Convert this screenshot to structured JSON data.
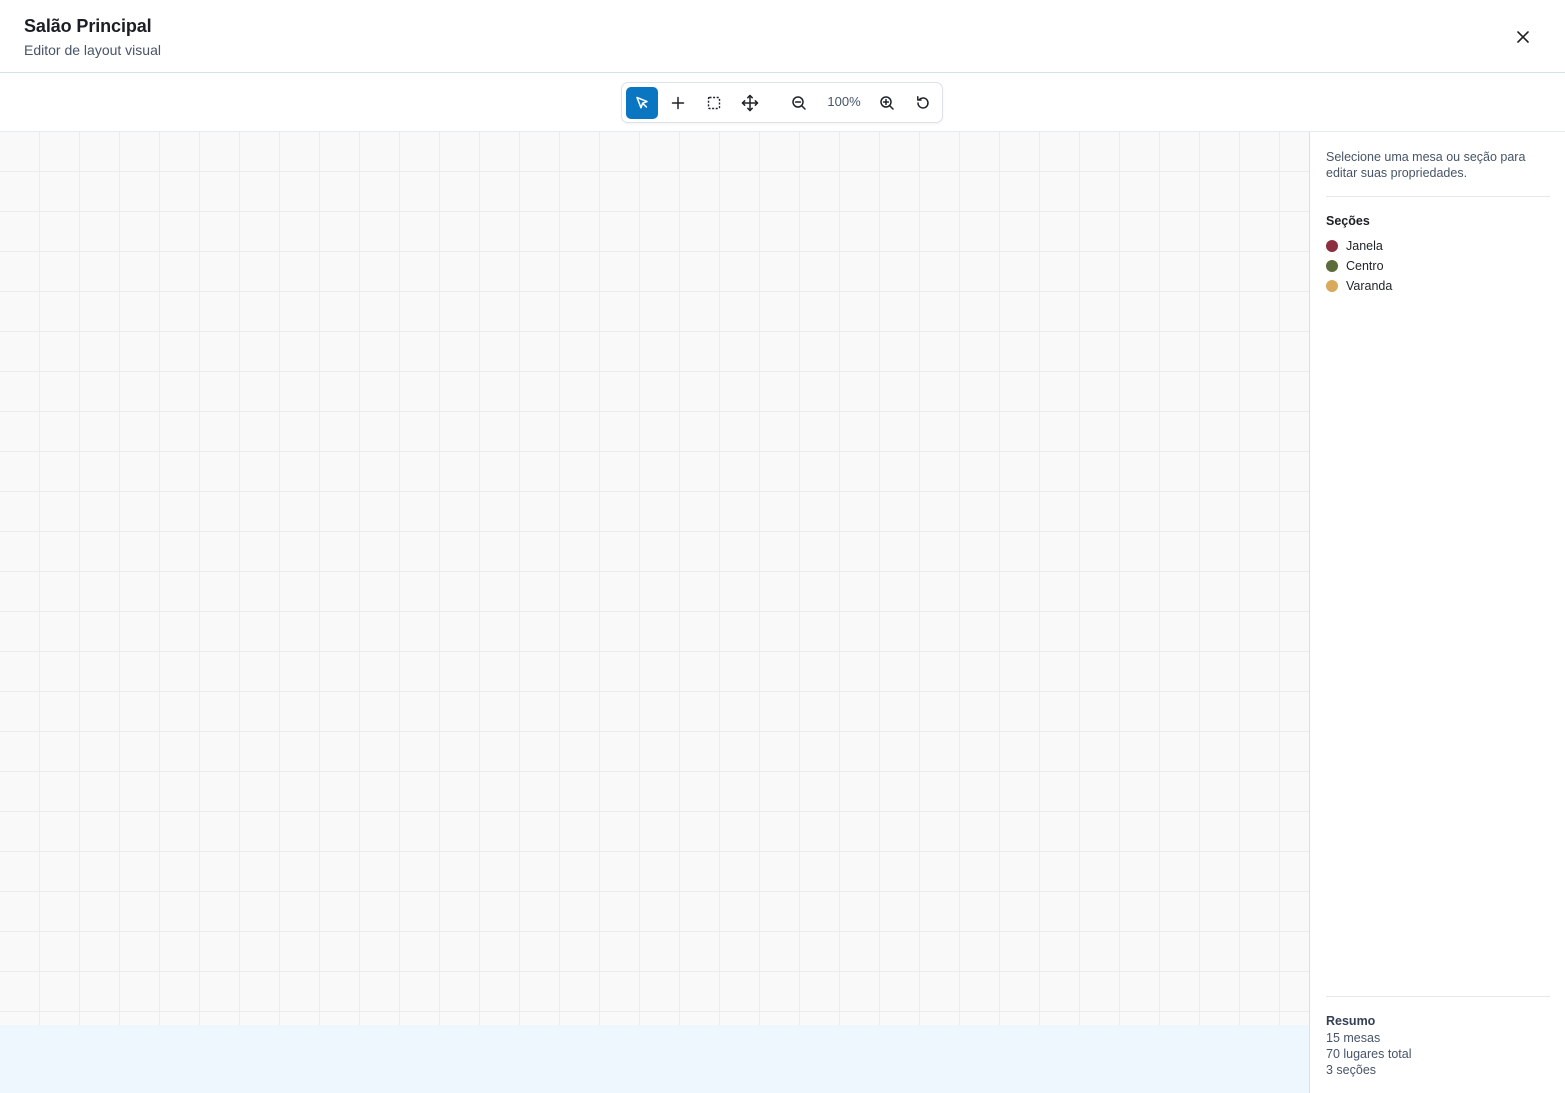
{
  "header": {
    "title": "Salão Principal",
    "subtitle": "Editor de layout visual",
    "close_icon": "close-icon"
  },
  "toolbar": {
    "tools": [
      {
        "id": "select",
        "icon": "pointer-icon",
        "active": true
      },
      {
        "id": "add-table",
        "icon": "plus-icon",
        "active": false
      },
      {
        "id": "add-section",
        "icon": "dashed-square-icon",
        "active": false
      },
      {
        "id": "pan",
        "icon": "move-icon",
        "active": false
      }
    ],
    "zoom_out_icon": "zoom-out-icon",
    "zoom_label": "100%",
    "zoom_in_icon": "zoom-in-icon",
    "reset_icon": "reset-icon",
    "active_color": "#0a76c2"
  },
  "side_panel": {
    "hint": "Selecione uma mesa ou seção para editar suas propriedades.",
    "sections_title": "Seções",
    "sections": [
      {
        "label": "Janela",
        "color": "#8b2e3f"
      },
      {
        "label": "Centro",
        "color": "#5b6b3a"
      },
      {
        "label": "Varanda",
        "color": "#d9a95c"
      }
    ],
    "summary": {
      "title": "Resumo",
      "tables": "15 mesas",
      "seats": "70 lugares total",
      "sections": "3 seções"
    }
  }
}
